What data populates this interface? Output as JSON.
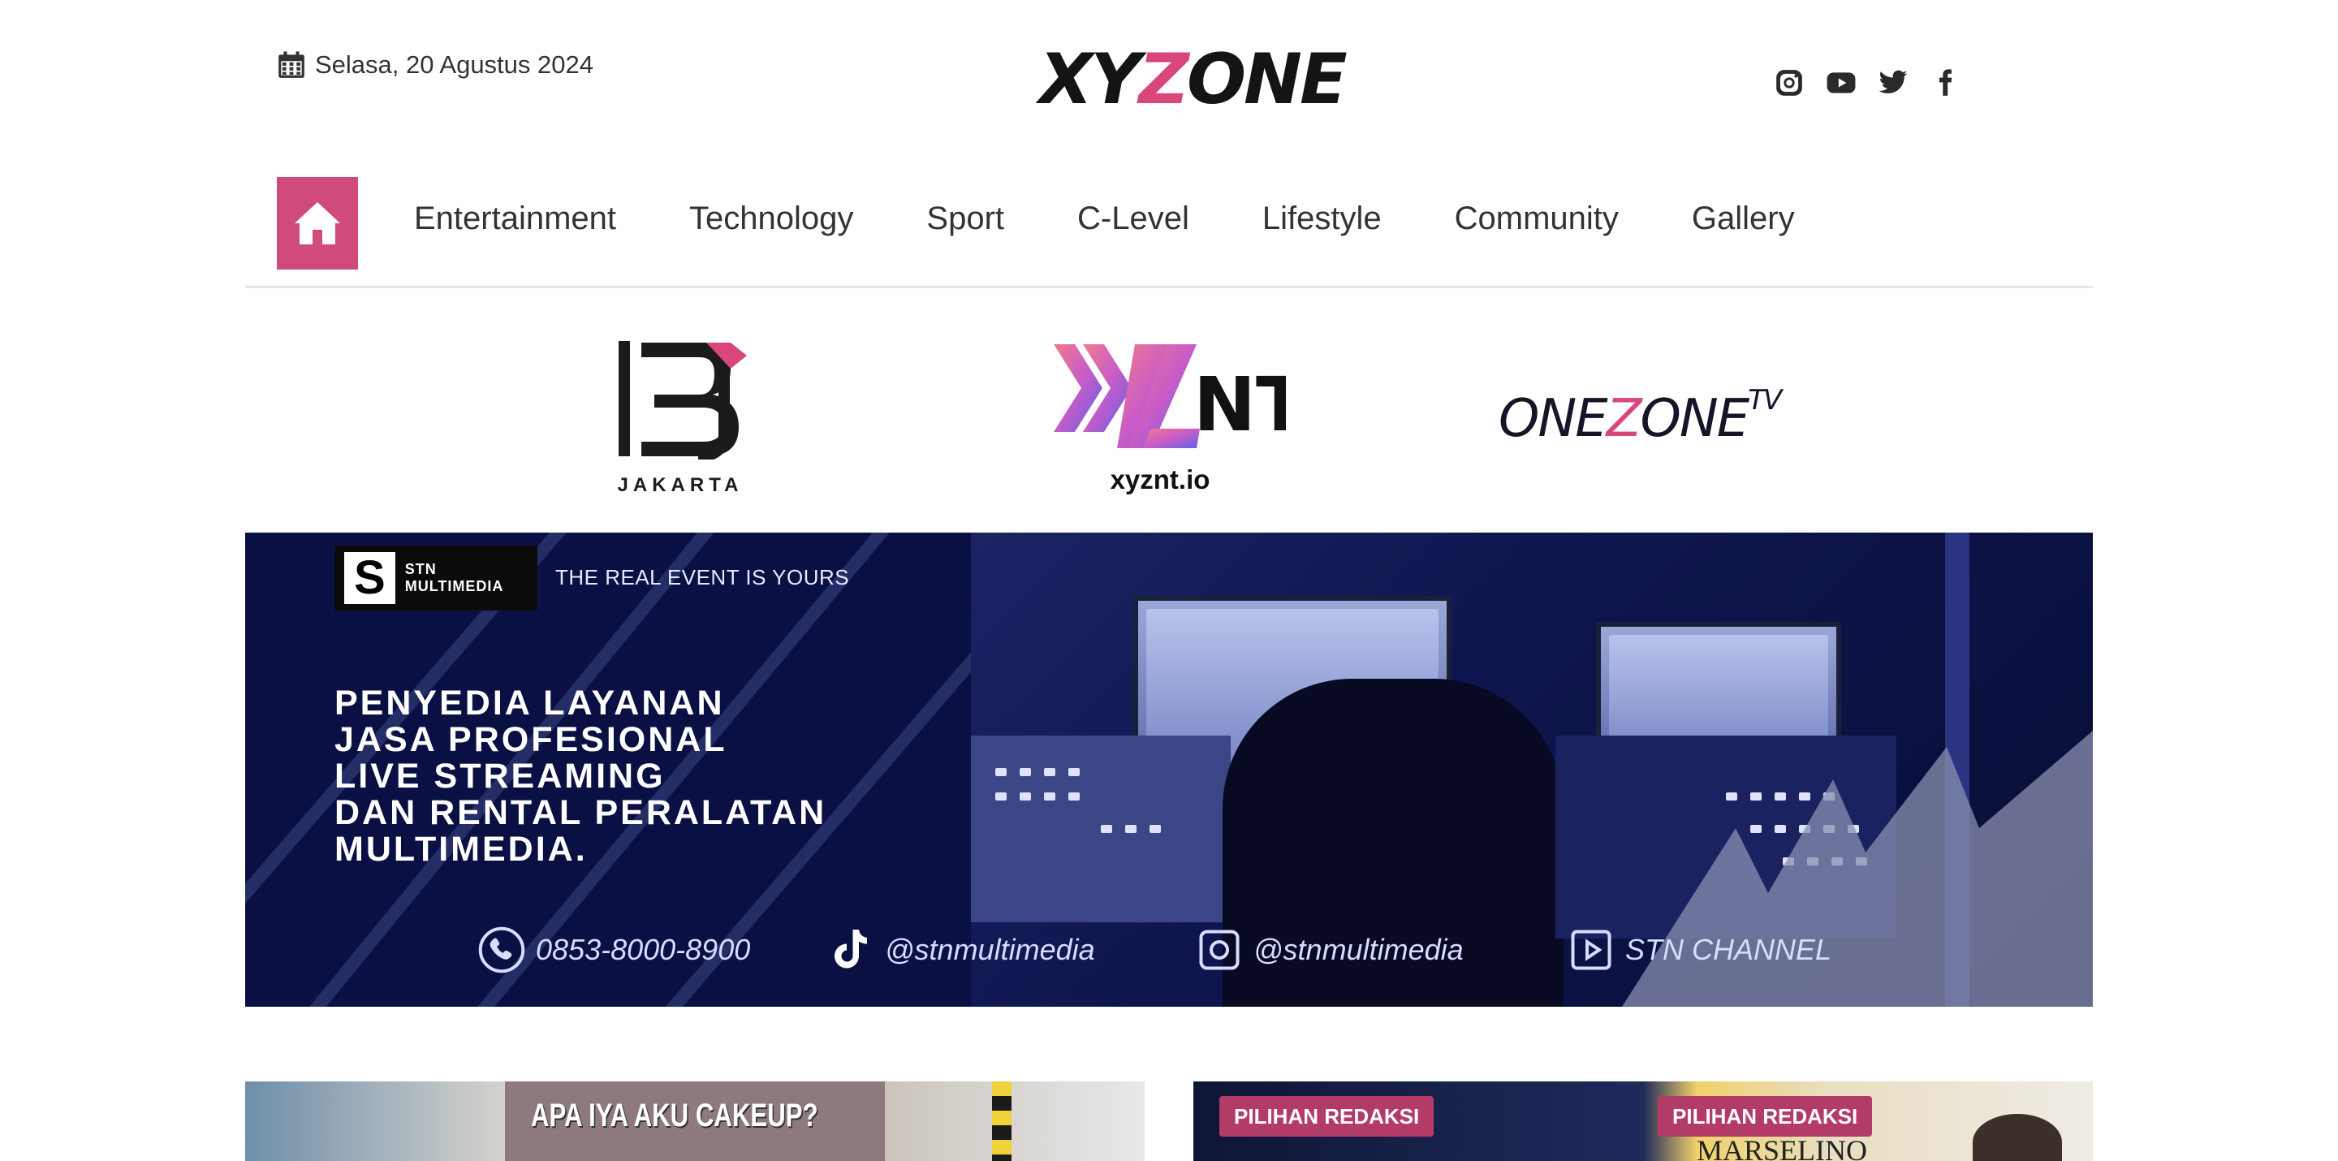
{
  "header": {
    "date": "Selasa, 20 Agustus 2024",
    "logo": {
      "part1": "XY",
      "part2": "Z",
      "part3": "ONE"
    },
    "social_icons": [
      "instagram-icon",
      "youtube-icon",
      "twitter-icon",
      "facebook-icon"
    ]
  },
  "nav": {
    "home_icon": "home-icon",
    "items": [
      "Entertainment",
      "Technology",
      "Sport",
      "C-Level",
      "Lifestyle",
      "Community",
      "Gallery"
    ]
  },
  "partners": {
    "lbj": {
      "caption": "JAKARTA"
    },
    "xyznt": {
      "caption": "xyznt.io"
    },
    "onezone": {
      "part1": "ONE",
      "part2": "Z",
      "part3": "ONE",
      "sup": "TV"
    }
  },
  "banner": {
    "brand_name": "STN MULTIMEDIA",
    "brand_letter": "S",
    "tagline": "THE REAL EVENT IS YOURS",
    "headline_lines": [
      "PENYEDIA LAYANAN",
      "JASA PROFESIONAL",
      "LIVE STREAMING",
      "DAN RENTAL PERALATAN",
      "MULTIMEDIA."
    ],
    "contacts": {
      "phone": "0853-8000-8900",
      "tiktok": "@stnmultimedia",
      "instagram": "@stnmultimedia",
      "youtube": "STN CHANNEL"
    }
  },
  "cards": {
    "card1": {
      "poster_text": "APA IYA AKU CAKEUP?"
    },
    "card2": {
      "badge1": "PILIHAN REDAKSI",
      "badge2": "PILIHAN REDAKSI",
      "caption": "MARSELINO"
    }
  },
  "colors": {
    "accent": "#d04a7b",
    "banner_bg": "#0b1240",
    "text": "#333333"
  }
}
